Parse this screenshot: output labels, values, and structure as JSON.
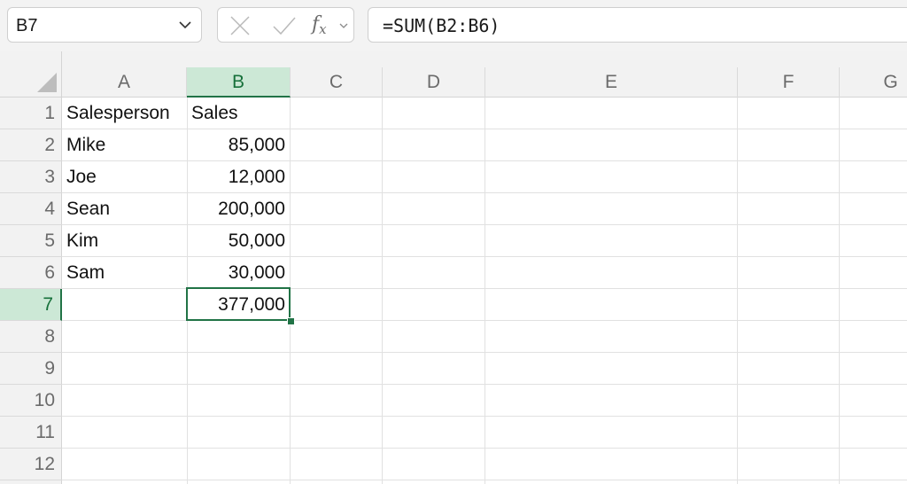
{
  "formula_bar": {
    "name_box": "B7",
    "fx_label": "fx",
    "formula": "=SUM(B2:B6)"
  },
  "icons": {
    "name_box_dropdown": "chevron-down-icon",
    "cancel": "close-icon",
    "enter": "check-icon",
    "function": "function-icon",
    "select_all": "select-all-triangle-icon"
  },
  "columns": [
    "A",
    "B",
    "C",
    "D",
    "E",
    "F",
    "G"
  ],
  "rows": [
    "1",
    "2",
    "3",
    "4",
    "5",
    "6",
    "7",
    "8",
    "9",
    "10",
    "11",
    "12"
  ],
  "selection": {
    "column": "B",
    "row": "7",
    "cell": "B7"
  },
  "cells": {
    "A1": "Salesperson",
    "B1": "Sales",
    "A2": "Mike",
    "B2": "85,000",
    "A3": "Joe",
    "B3": "12,000",
    "A4": "Sean",
    "B4": "200,000",
    "A5": "Kim",
    "B5": "50,000",
    "A6": "Sam",
    "B6": "30,000",
    "B7": "377,000"
  },
  "colors": {
    "accent": "#217346",
    "selected_header_bg": "#cce8d6",
    "header_bg": "#f2f2f2"
  }
}
